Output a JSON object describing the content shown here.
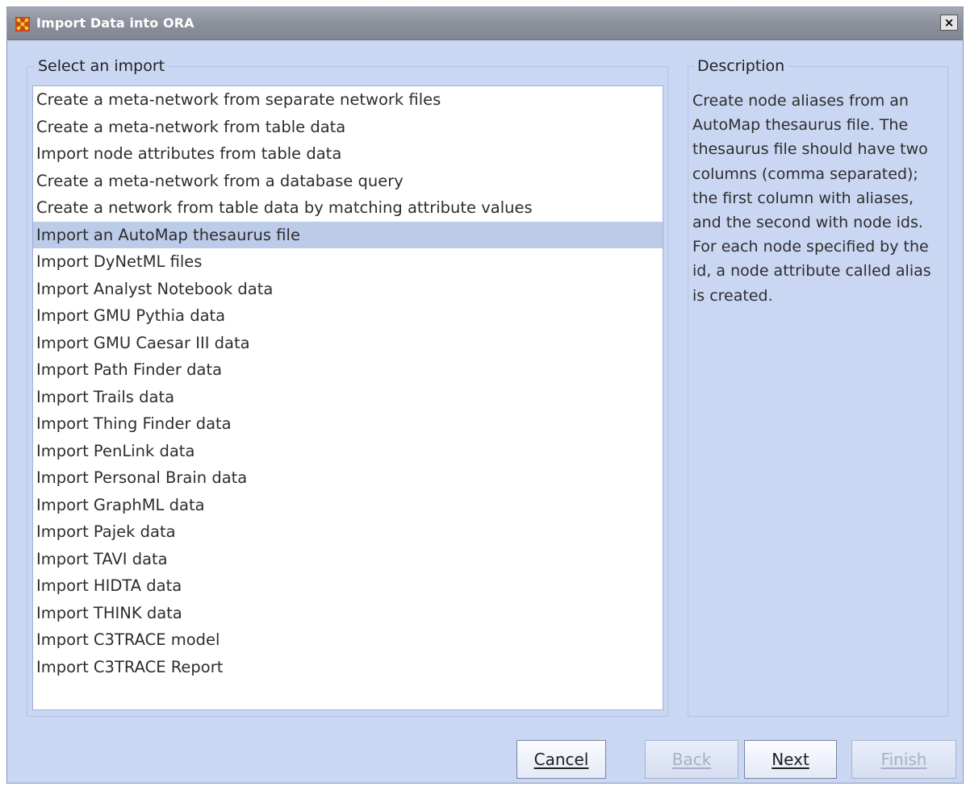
{
  "window": {
    "title": "Import Data into ORA",
    "close_label": "×"
  },
  "imports": {
    "label": "Select an import",
    "items": [
      "Create a meta-network from separate network files",
      "Create a meta-network from table data",
      "Import node attributes from table data",
      "Create a meta-network from a database query",
      "Create a network from table data by matching attribute values",
      "Import an AutoMap thesaurus file",
      "Import DyNetML files",
      "Import Analyst Notebook data",
      "Import GMU Pythia data",
      "Import GMU Caesar III data",
      "Import Path Finder data",
      "Import Trails data",
      "Import Thing Finder data",
      "Import PenLink data",
      "Import Personal Brain data",
      "Import GraphML data",
      "Import Pajek data",
      "Import TAVI data",
      "Import HIDTA data",
      "Import THINK data",
      "Import C3TRACE model",
      "Import C3TRACE Report"
    ],
    "selected_index": 5
  },
  "description": {
    "label": "Description",
    "text": "Create node aliases from an AutoMap thesaurus file. The thesaurus file should have two columns (comma separated); the first column with aliases, and the second with node ids. For each node specified by the id, a node attribute called alias is created."
  },
  "buttons": {
    "cancel": "Cancel",
    "back": "Back",
    "next": "Next",
    "finish": "Finish"
  },
  "colors": {
    "window_bg": "#cad7f3",
    "selected_row": "#bccbe8",
    "disabled_text": "#a7b0c6"
  }
}
